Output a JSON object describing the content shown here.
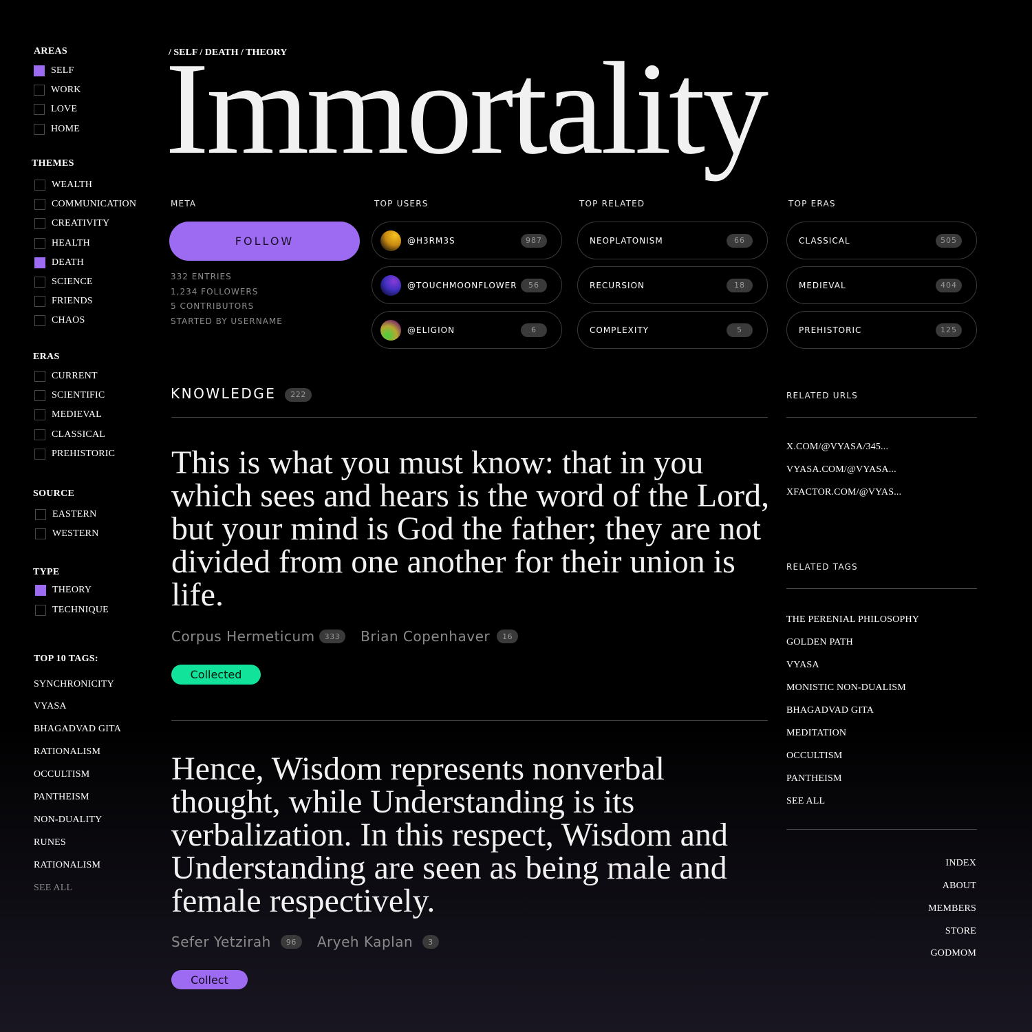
{
  "sidebar": {
    "areas": {
      "heading": "AREAS",
      "items": [
        {
          "label": "SELF",
          "checked": true
        },
        {
          "label": "WORK",
          "checked": false
        },
        {
          "label": "LOVE",
          "checked": false
        },
        {
          "label": "HOME",
          "checked": false
        }
      ]
    },
    "themes": {
      "heading": "THEMES",
      "items": [
        {
          "label": "WEALTH",
          "checked": false
        },
        {
          "label": "COMMUNICATION",
          "checked": false
        },
        {
          "label": "CREATIVITY",
          "checked": false
        },
        {
          "label": "HEALTH",
          "checked": false
        },
        {
          "label": "DEATH",
          "checked": true
        },
        {
          "label": "SCIENCE",
          "checked": false
        },
        {
          "label": "FRIENDS",
          "checked": false
        },
        {
          "label": "CHAOS",
          "checked": false
        }
      ]
    },
    "eras": {
      "heading": "ERAS",
      "items": [
        {
          "label": "CURRENT",
          "checked": false
        },
        {
          "label": "SCIENTIFIC",
          "checked": false
        },
        {
          "label": "MEDIEVAL",
          "checked": false
        },
        {
          "label": "CLASSICAL",
          "checked": false
        },
        {
          "label": "PREHISTORIC",
          "checked": false
        }
      ]
    },
    "source": {
      "heading": "SOURCE",
      "items": [
        {
          "label": "EASTERN",
          "checked": false
        },
        {
          "label": "WESTERN",
          "checked": false
        }
      ]
    },
    "type": {
      "heading": "TYPE",
      "items": [
        {
          "label": "THEORY",
          "checked": true
        },
        {
          "label": "TECHNIQUE",
          "checked": false
        }
      ]
    },
    "top_tags": {
      "heading": "TOP 10 TAGS:",
      "items": [
        "SYNCHRONICITY",
        "VYASA",
        "BHAGADVAD GITA",
        "RATIONALISM",
        "OCCULTISM",
        "PANTHEISM",
        "NON-DUALITY",
        "RUNES",
        "RATIONALISM"
      ],
      "see_all": "SEE ALL"
    }
  },
  "breadcrumb": [
    "/ SELF",
    "/ DEATH",
    "/ ",
    "THEORY"
  ],
  "title": "Immortality",
  "meta": {
    "heading": "META",
    "follow_label": "FOLLOW",
    "lines": [
      "332 ENTRIES",
      "1,234 FOLLOWERS",
      "5 CONTRIBUTORS",
      "STARTED BY USERNAME"
    ]
  },
  "top_users": {
    "heading": "TOP USERS",
    "items": [
      {
        "name": "@H3RM3S",
        "count": "987",
        "avatar": "avatar-gold-icon"
      },
      {
        "name": "@TOUCHMOONFLOWER",
        "count": "56",
        "avatar": "avatar-violet-icon"
      },
      {
        "name": "@ELIGION",
        "count": "6",
        "avatar": "avatar-green-icon"
      }
    ]
  },
  "top_related": {
    "heading": "TOP RELATED",
    "items": [
      {
        "name": "NEOPLATONISM",
        "count": "66"
      },
      {
        "name": "RECURSION",
        "count": "18"
      },
      {
        "name": "COMPLEXITY",
        "count": "5"
      }
    ]
  },
  "top_eras": {
    "heading": "TOP ERAS",
    "items": [
      {
        "name": "CLASSICAL",
        "count": "505"
      },
      {
        "name": "MEDIEVAL",
        "count": "404"
      },
      {
        "name": "PREHISTORIC",
        "count": "125"
      }
    ]
  },
  "knowledge": {
    "heading": "KNOWLEDGE",
    "count": "222",
    "entries": [
      {
        "quote": "This is what you must know: that in you which sees and hears is the word of the Lord, but your mind is God the father; they are not divided from one another for their union is life.",
        "source": "Corpus Hermeticum",
        "source_count": "333",
        "author": "Brian Copenhaver",
        "author_count": "16",
        "action": "Collected"
      },
      {
        "quote": "Hence, Wisdom represents nonverbal thought, while Understanding is its verbalization. In this respect, Wisdom and Understanding are seen as being male and female respectively.",
        "source": "Sefer Yetzirah",
        "source_count": "96",
        "author": "Aryeh Kaplan",
        "author_count": "3",
        "action": "Collect"
      }
    ]
  },
  "related_urls": {
    "heading": "RELATED URLS",
    "items": [
      "X.COM/@VYASA/345...",
      "VYASA.COM/@VYASA...",
      "XFACTOR.COM/@VYAS..."
    ]
  },
  "related_tags": {
    "heading": "RELATED TAGS",
    "items": [
      "THE PERENIAL PHILOSOPHY",
      "GOLDEN PATH",
      "VYASA",
      "MONISTIC NON-DUALISM",
      "BHAGADVAD GITA",
      "MEDITATION",
      "OCCULTISM",
      "PANTHEISM",
      "SEE ALL"
    ]
  },
  "footer_nav": [
    "INDEX",
    "ABOUT",
    "MEMBERS",
    "STORE",
    "GODMOM"
  ],
  "colors": {
    "accent": "#9d6bf2",
    "collected": "#12e39a",
    "background": "#000000"
  }
}
